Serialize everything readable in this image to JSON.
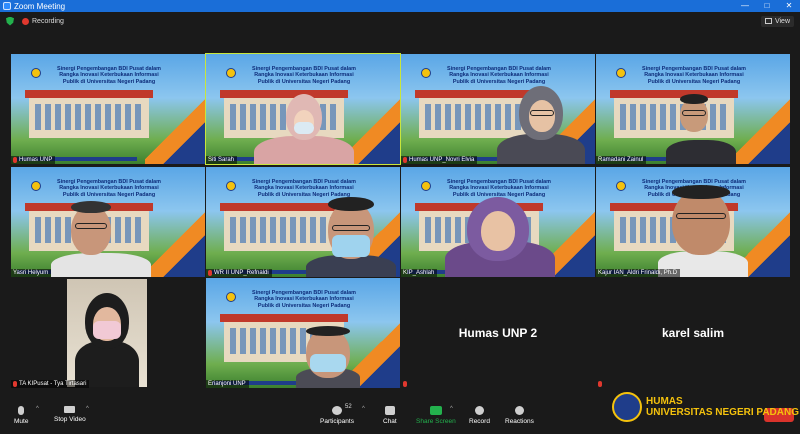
{
  "window": {
    "title": "Zoom Meeting"
  },
  "window_controls": {
    "minimize": "—",
    "maximize": "□",
    "close": "✕"
  },
  "topbar": {
    "recording_label": "Recording",
    "view_label": "View"
  },
  "banner_text": "Sinergi Pengembangan BDI Pusat dalam Rangka Inovasi Keterbukaan Informasi Publik di Universitas Negeri Padang",
  "participants": [
    {
      "name": "Humas UNP"
    },
    {
      "name": "Siti Sarah"
    },
    {
      "name": "Humas UNP_Novri Elvia"
    },
    {
      "name": "Ramadani Zainul"
    },
    {
      "name": "Yasri Helyum"
    },
    {
      "name": "WR II UNP_Refnaldi"
    },
    {
      "name": "KIP_Ashlah"
    },
    {
      "name": "Kajur IAN_Aldri Frinaldi, Ph.D"
    },
    {
      "name": "TA KIPusat - Tya Tirtasari"
    },
    {
      "name": "Erianjoni UNP"
    },
    {
      "name": "Humas UNP 2"
    },
    {
      "name": "karel salim"
    }
  ],
  "toolbar": {
    "mute": "Mute",
    "stop_video": "Stop Video",
    "participants": "Participants",
    "participants_count": "52",
    "chat": "Chat",
    "share_screen": "Share Screen",
    "record": "Record",
    "reactions": "Reactions"
  },
  "watermark": {
    "line1": "HUMAS",
    "line2": "UNIVERSITAS NEGERI PADANG"
  },
  "colors": {
    "titlebar": "#1a6ed8",
    "active_speaker": "#c8e63c",
    "share": "#23b14d",
    "gold": "#f4c20d"
  }
}
